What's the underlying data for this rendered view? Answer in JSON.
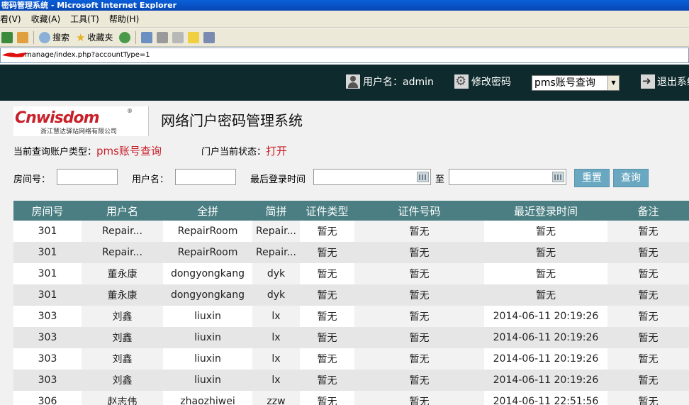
{
  "window": {
    "title": "密码管理系统 - Microsoft Internet Explorer"
  },
  "menu": [
    "看(V)",
    "收藏(A)",
    "工具(T)",
    "帮助(H)"
  ],
  "toolbar": {
    "search": "搜索",
    "favorites": "收藏夹"
  },
  "address": {
    "url": "manage/index.php?accountType=1"
  },
  "header": {
    "user_label": "用户名：admin",
    "change_password": "修改密码",
    "account_select": "pms账号查询",
    "logout": "退出系统"
  },
  "logo": {
    "brand": "Cnwisdom",
    "reg": "®",
    "sub": "浙江慧达驿站网络有限公司"
  },
  "system_title": "网络门户密码管理系统",
  "status": {
    "type_label": "当前查询账户类型：",
    "type_value": "pms账号查询",
    "portal_label": "门户当前状态：",
    "portal_value": "打开"
  },
  "filter": {
    "room_label": "房间号：",
    "user_label": "用户名：",
    "login_label": "最后登录时间",
    "to_label": "至",
    "reset": "重置",
    "query": "查询"
  },
  "table": {
    "headers": [
      "房间号",
      "用户名",
      "全拼",
      "简拼",
      "证件类型",
      "证件号码",
      "最近登录时间",
      "备注"
    ],
    "rows": [
      [
        "301",
        "Repair...",
        "RepairRoom",
        "Repair...",
        "暂无",
        "暂无",
        "暂无",
        "暂无"
      ],
      [
        "301",
        "Repair...",
        "RepairRoom",
        "Repair...",
        "暂无",
        "暂无",
        "暂无",
        "暂无"
      ],
      [
        "301",
        "董永康",
        "dongyongkang",
        "dyk",
        "暂无",
        "暂无",
        "暂无",
        "暂无"
      ],
      [
        "301",
        "董永康",
        "dongyongkang",
        "dyk",
        "暂无",
        "暂无",
        "暂无",
        "暂无"
      ],
      [
        "303",
        "刘鑫",
        "liuxin",
        "lx",
        "暂无",
        "暂无",
        "2014-06-11 20:19:26",
        "暂无"
      ],
      [
        "303",
        "刘鑫",
        "liuxin",
        "lx",
        "暂无",
        "暂无",
        "2014-06-11 20:19:26",
        "暂无"
      ],
      [
        "303",
        "刘鑫",
        "liuxin",
        "lx",
        "暂无",
        "暂无",
        "2014-06-11 20:19:26",
        "暂无"
      ],
      [
        "303",
        "刘鑫",
        "liuxin",
        "lx",
        "暂无",
        "暂无",
        "2014-06-11 20:19:26",
        "暂无"
      ],
      [
        "306",
        "赵志伟",
        "zhaozhiwei",
        "zzw",
        "暂无",
        "暂无",
        "2014-06-11 22:51:56",
        "暂无"
      ]
    ]
  },
  "colors": {
    "header_bg": "#0e2a2c",
    "table_head": "#4a7e82",
    "accent_red": "#c8202a",
    "button": "#6aa8c2"
  }
}
